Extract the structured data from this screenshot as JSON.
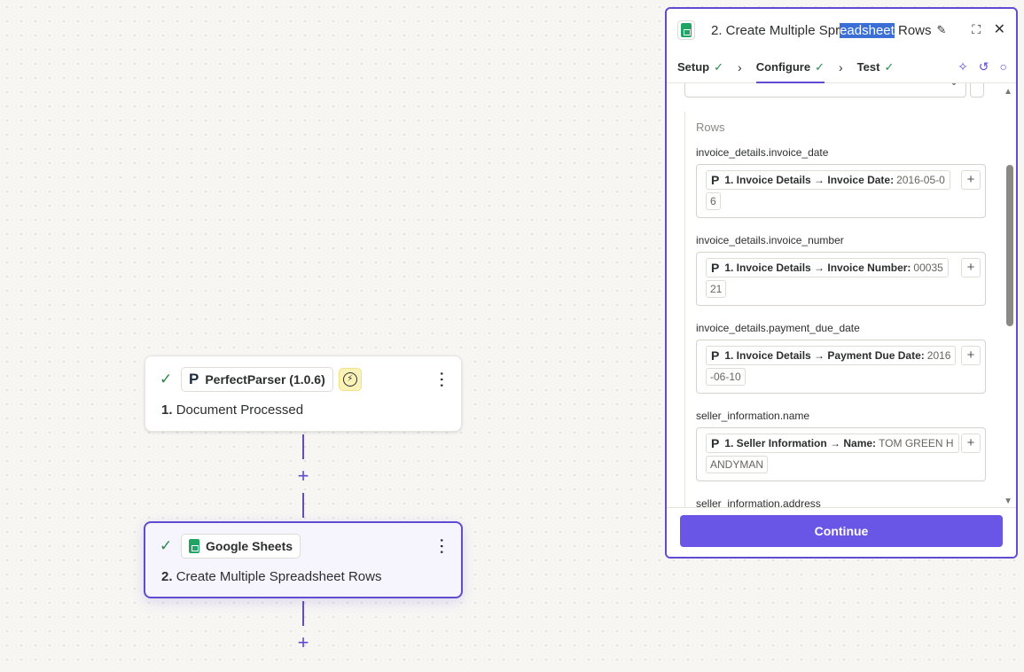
{
  "nodes": [
    {
      "step": "1.",
      "title": "Document Processed",
      "app_name": "PerfectParser (1.0.6)"
    },
    {
      "step": "2.",
      "title": "Create Multiple Spreadsheet Rows",
      "app_name": "Google Sheets"
    }
  ],
  "panel": {
    "title_pre": "2. Create Multiple Spr",
    "title_highlight": "eadsheet",
    "title_post": " Rows",
    "tabs": [
      {
        "label": "Setup"
      },
      {
        "label": "Configure"
      },
      {
        "label": "Test"
      }
    ],
    "rows_label": "Rows",
    "fields": [
      {
        "label": "invoice_details.invoice_date",
        "pill_text": "1. Invoice Details → Invoice Date:",
        "value_start": "2016-05-0",
        "value_cont": "6"
      },
      {
        "label": "invoice_details.invoice_number",
        "pill_text": "1. Invoice Details → Invoice Number:",
        "value_start": "00035",
        "value_cont": "21"
      },
      {
        "label": "invoice_details.payment_due_date",
        "pill_text": "1. Invoice Details → Payment Due Date:",
        "value_start": "2016",
        "value_cont": "-06-10"
      },
      {
        "label": "seller_information.name",
        "pill_text": "1. Seller Information → Name:",
        "value_start": "TOM GREEN H",
        "value_cont": "ANDYMAN"
      },
      {
        "label": "seller_information.address",
        "pill_text": "",
        "value_start": "",
        "value_cont": ""
      }
    ],
    "continue_label": "Continue"
  },
  "colors": {
    "accent": "#5f4cd2",
    "button": "#6955e6",
    "check": "#2a8a4a",
    "sheets_green": "#1fa463"
  },
  "icons": {
    "check": "check-icon",
    "app_logo": "perfectparser-logo-icon",
    "trigger": "lightning-icon",
    "sheets": "google-sheets-icon",
    "menu": "kebab-menu-icon",
    "add": "plus-icon"
  }
}
